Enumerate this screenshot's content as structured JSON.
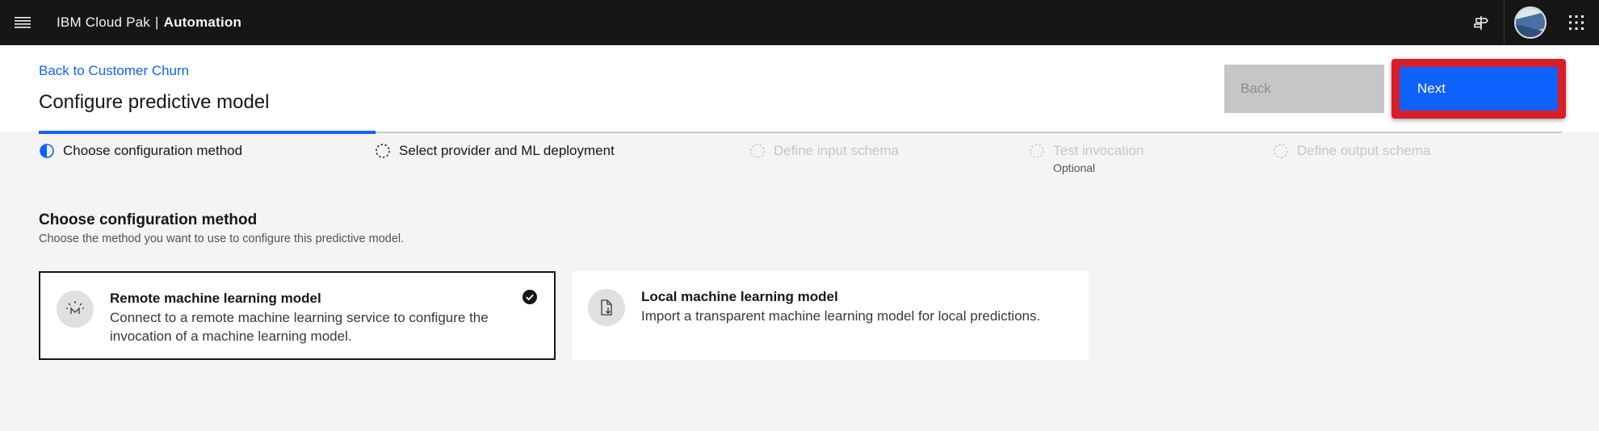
{
  "header": {
    "brand_prefix": "IBM Cloud Pak",
    "brand_separator": "|",
    "brand_product": "Automation",
    "icons": [
      "menu-icon",
      "signpost-icon",
      "avatar",
      "app-switcher-icon"
    ]
  },
  "page": {
    "back_link": "Back to Customer Churn",
    "title": "Configure predictive model",
    "back_button": "Back",
    "next_button": "Next"
  },
  "steps": [
    {
      "label": "Choose configuration method",
      "state": "current"
    },
    {
      "label": "Select provider and ML deployment",
      "state": "incomplete"
    },
    {
      "label": "Define input schema",
      "state": "disabled"
    },
    {
      "label": "Test invocation",
      "state": "disabled",
      "secondary": "Optional"
    },
    {
      "label": "Define output schema",
      "state": "disabled"
    }
  ],
  "section": {
    "title": "Choose configuration method",
    "description": "Choose the method you want to use to configure this predictive model."
  },
  "tiles": [
    {
      "title": "Remote machine learning model",
      "description": "Connect to a remote machine learning service to configure the invocation of a machine learning model.",
      "selected": true,
      "icon": "machine-learning-model-icon"
    },
    {
      "title": "Local machine learning model",
      "description": "Import a transparent machine learning model for local predictions.",
      "selected": false,
      "icon": "document-import-icon"
    }
  ],
  "colors": {
    "accent": "#0f62fe",
    "highlight": "#da1e28",
    "header_bg": "#161616"
  }
}
